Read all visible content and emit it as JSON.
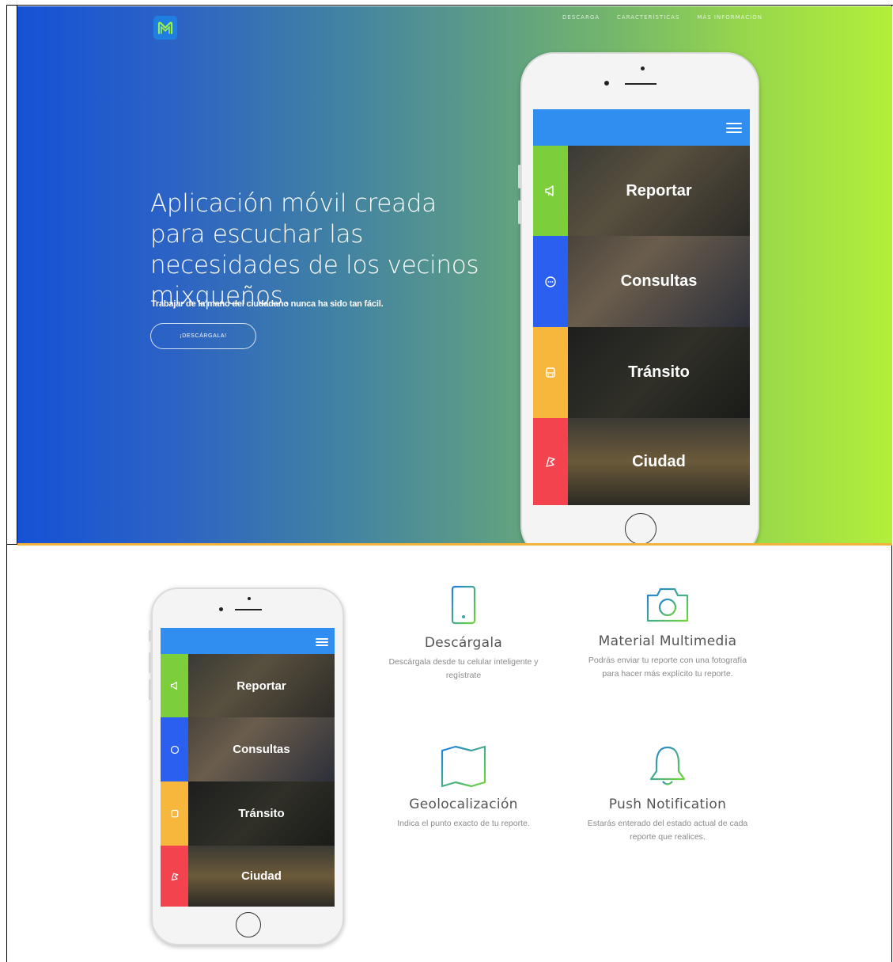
{
  "colors": {
    "gradient_start": "#1552d6",
    "gradient_end": "#b3ee3a",
    "accent_blue": "#2f8ef0",
    "tab_green": "#7ccf3a",
    "tab_blue": "#2a5ff0",
    "tab_yellow": "#f6b73c",
    "tab_red": "#f2434f",
    "orange_line": "#f3b23a"
  },
  "nav": {
    "logo_icon": "m-logo-icon",
    "items": [
      "DESCARGA",
      "CARACTERÍSTICAS",
      "MÁS INFORMACIÓN"
    ]
  },
  "hero": {
    "title": "Aplicación móvil creada para escuchar las necesidades de los vecinos mixqueños.",
    "subtitle": "Trabajar de la mano del ciudadano nunca ha sido tan fácil.",
    "button_label": "¡DESCÁRGALA!"
  },
  "app_menu": {
    "items": [
      {
        "label": "Reportar",
        "icon": "megaphone-icon",
        "color": "#7ccf3a"
      },
      {
        "label": "Consultas",
        "icon": "chat-icon",
        "color": "#2a5ff0"
      },
      {
        "label": "Tránsito",
        "icon": "bus-icon",
        "color": "#f6b73c"
      },
      {
        "label": "Ciudad",
        "icon": "flag-icon",
        "color": "#f2434f"
      }
    ]
  },
  "features": [
    {
      "title": "Descárgala",
      "desc": "Descárgala desde tu celular inteligente y regístrate",
      "icon": "smartphone-icon"
    },
    {
      "title": "Material Multimedia",
      "desc": "Podrás enviar tu reporte con una fotografía para hacer más explícito tu reporte.",
      "icon": "camera-icon"
    },
    {
      "title": "Geolocalización",
      "desc": "Indica el punto exacto de tu reporte.",
      "icon": "map-icon"
    },
    {
      "title": "Push Notification",
      "desc": "Estarás enterado del estado actual de cada reporte que realices.",
      "icon": "bell-icon"
    }
  ]
}
